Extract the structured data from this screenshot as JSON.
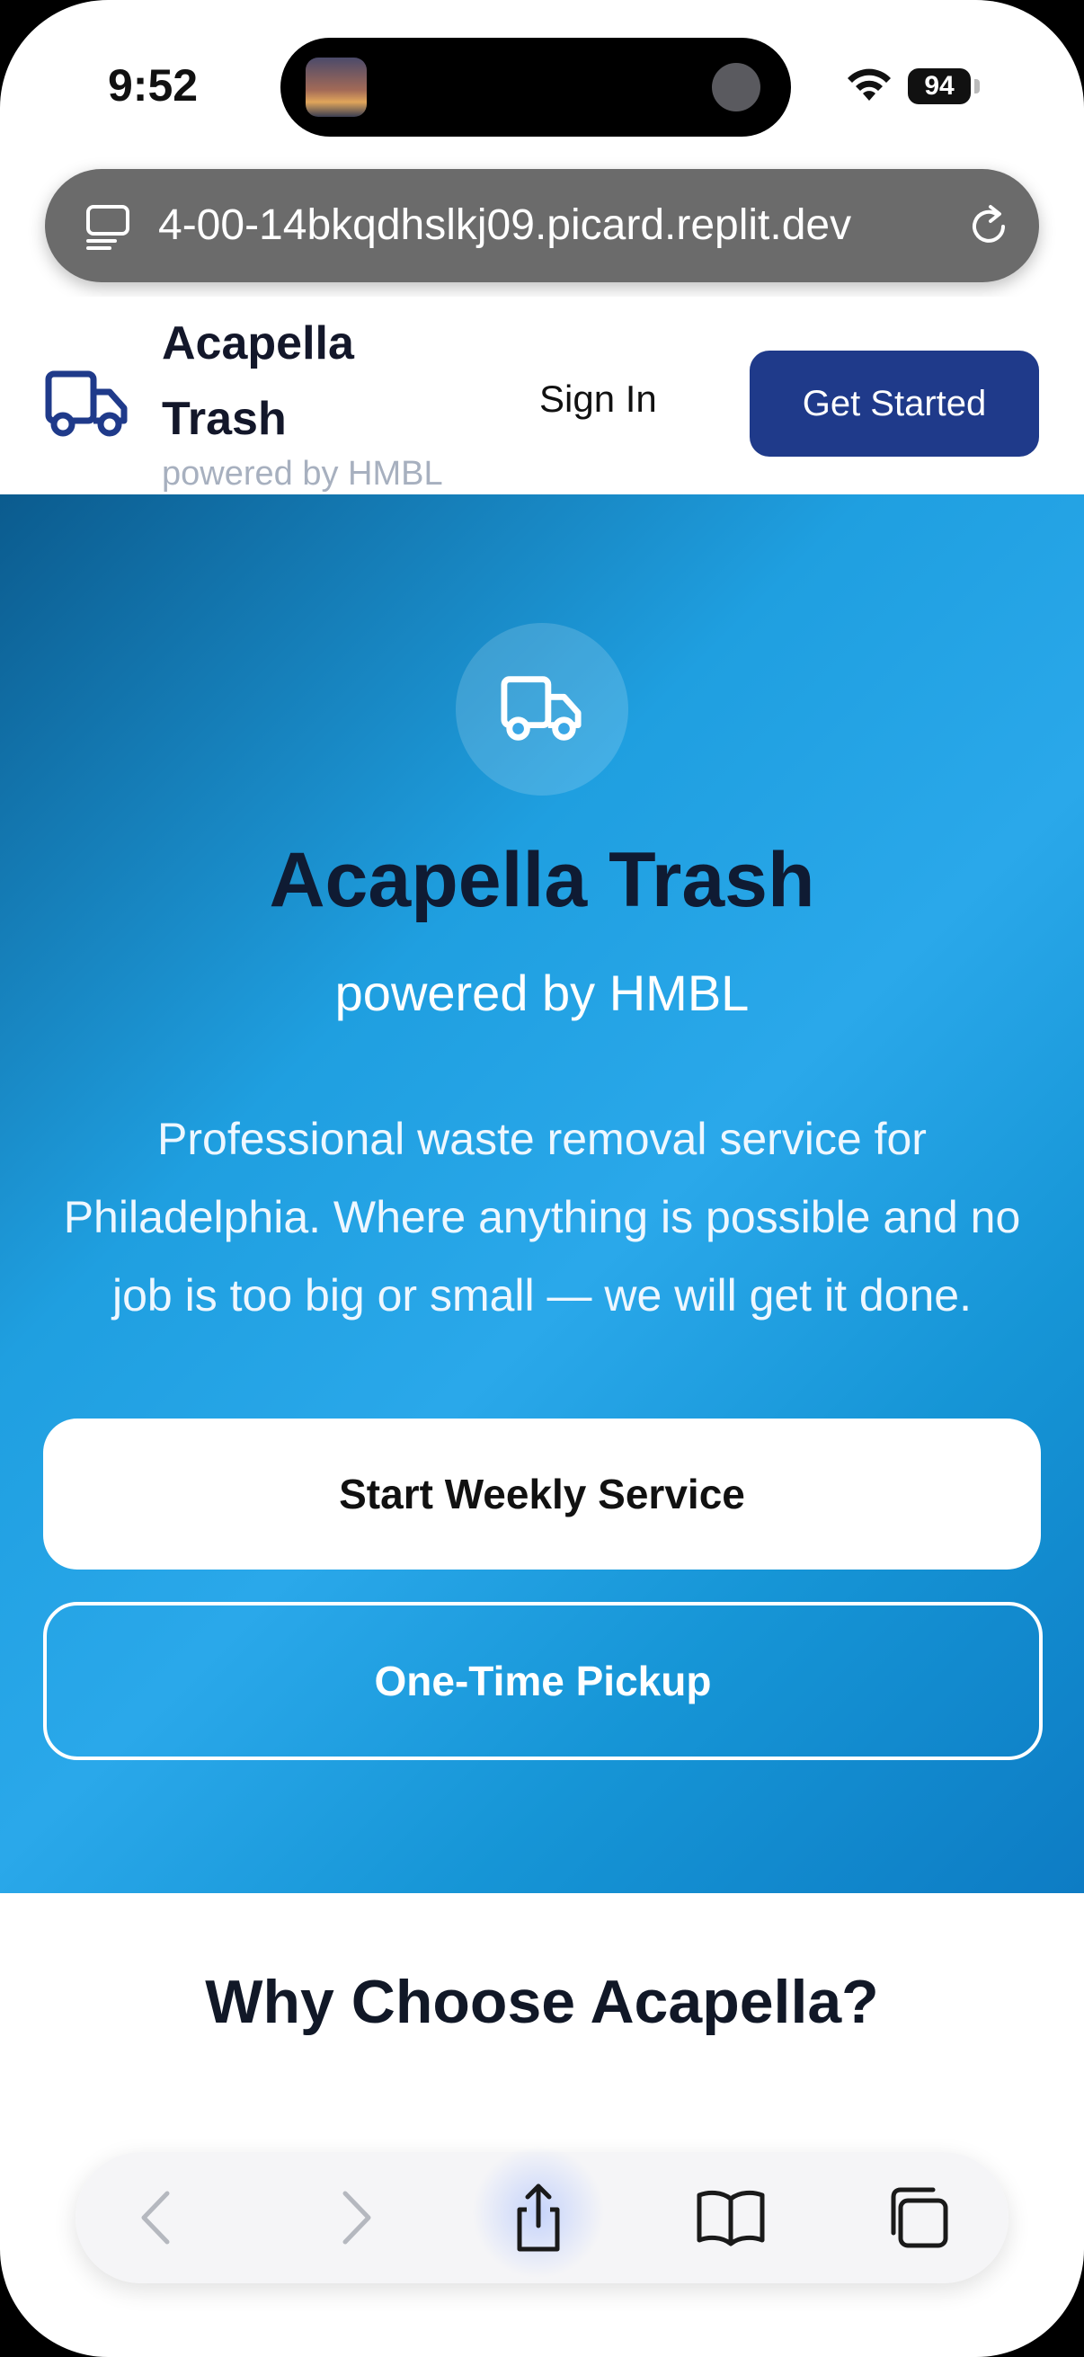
{
  "status_bar": {
    "time": "9:52",
    "battery": "94"
  },
  "browser": {
    "url": "4-00-14bkqdhslkj09.picard.replit.dev"
  },
  "header": {
    "brand_name": "Acapella Trash",
    "brand_sub": "powered by HMBL",
    "signin_label": "Sign In",
    "cta_label": "Get Started"
  },
  "hero": {
    "title": "Acapella Trash",
    "powered": "powered by HMBL",
    "description": "Professional waste removal service for Philadelphia. Where anything is possible and no job is too big or small — we will get it done.",
    "primary_button": "Start Weekly Service",
    "secondary_button": "One-Time Pickup"
  },
  "section": {
    "why_title": "Why Choose Acapella?"
  },
  "toolbar": {
    "icons": [
      "back-icon",
      "forward-icon",
      "share-icon",
      "bookmarks-icon",
      "tabs-icon"
    ]
  },
  "colors": {
    "accent": "#1f3a8a",
    "hero_start": "#0b5b8e",
    "hero_end": "#2aa8ea",
    "title_dark": "#0f1b33"
  }
}
